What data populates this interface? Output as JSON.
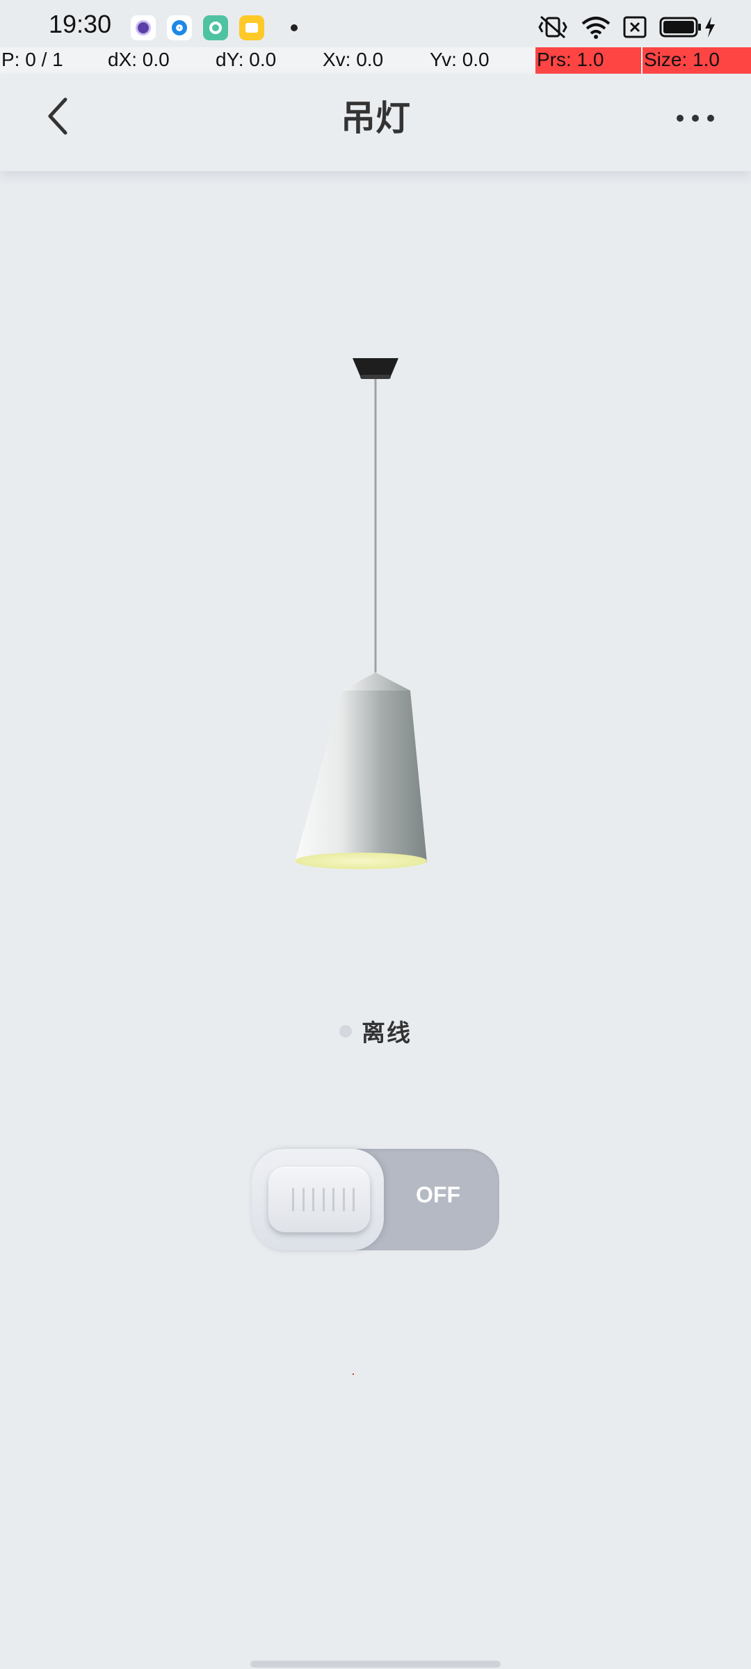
{
  "status_bar": {
    "time": "19:30",
    "notification_icons": [
      "vpn-app-icon",
      "browser-app-icon",
      "camera-app-icon",
      "notes-app-icon"
    ],
    "system_icons": [
      "vibrate-mute-icon",
      "wifi-icon",
      "sim-disabled-icon",
      "battery-icon",
      "charging-icon"
    ]
  },
  "debug": {
    "p": "P: 0 / 1",
    "dx": "dX: 0.0",
    "dy": "dY: 0.0",
    "xv": "Xv: 0.0",
    "yv": "Yv: 0.0",
    "prs": "Prs: 1.0",
    "size": "Size: 1.0"
  },
  "header": {
    "title": "吊灯"
  },
  "device": {
    "status_text": "离线",
    "status_color": "#d3d7de"
  },
  "switch": {
    "label": "OFF",
    "state": "off"
  },
  "colors": {
    "background": "#e9ecef",
    "switch_track": "#b4b9c4",
    "debug_highlight": "#ff4444"
  }
}
